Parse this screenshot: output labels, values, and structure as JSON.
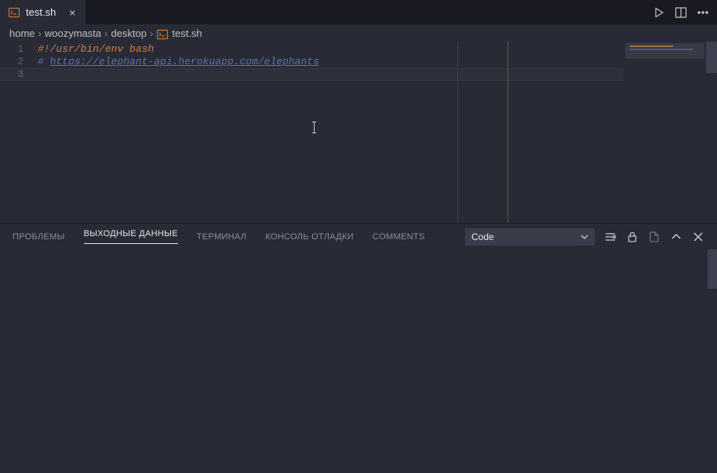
{
  "tab": {
    "icon": "shell-file-icon",
    "label": "test.sh"
  },
  "breadcrumbs": [
    "home",
    "woozymasta",
    "desktop",
    "test.sh"
  ],
  "code": {
    "lines": [
      {
        "n": 1,
        "shebang": "#!/usr/bin/env bash"
      },
      {
        "n": 2,
        "hash": "# ",
        "url": "https://elephant-api.herokuapp.com/elephants"
      },
      {
        "n": 3,
        "text": ""
      }
    ]
  },
  "panel": {
    "tabs": [
      "ПРОБЛЕМЫ",
      "ВЫХОДНЫЕ ДАННЫЕ",
      "ТЕРМИНАЛ",
      "КОНСОЛЬ ОТЛАДКИ",
      "COMMENTS"
    ],
    "active_index": 1,
    "output_channel": "Code"
  }
}
